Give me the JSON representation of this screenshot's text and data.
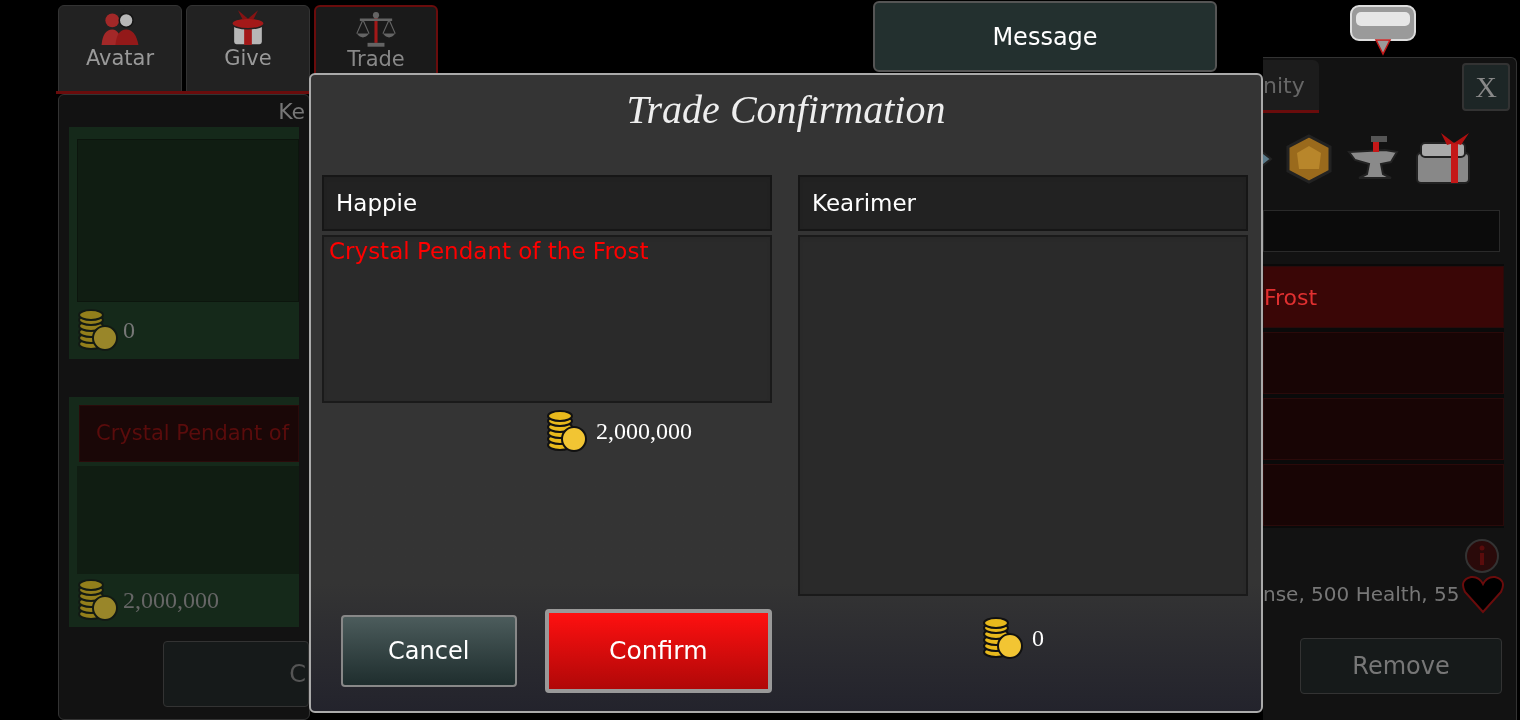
{
  "nav_tabs": [
    {
      "label": "Avatar",
      "selected": false
    },
    {
      "label": "Give",
      "selected": false
    },
    {
      "label": "Trade",
      "selected": true
    }
  ],
  "left_panel": {
    "heading": "Ke",
    "top_offer": {
      "gold": "0"
    },
    "bottom_offer": {
      "item": "Crystal Pendant of",
      "gold": "2,000,000"
    },
    "button": "C"
  },
  "message_button": "Message",
  "right_panel": {
    "tab": "nity",
    "close": "X",
    "list_rows": [
      {
        "label": "Frost",
        "selected": true
      },
      {
        "selected": false
      },
      {
        "selected": false
      },
      {
        "selected": false
      }
    ],
    "description": "nse, 500 Health, 55",
    "button": "Remove"
  },
  "modal": {
    "title": "Trade Confirmation",
    "parties": [
      {
        "name": "Happie",
        "items": [
          "Crystal Pendant of the Frost"
        ],
        "gold": "2,000,000"
      },
      {
        "name": "Kearimer",
        "gold": "0"
      }
    ],
    "buttons": [
      {
        "label": "Cancel",
        "kind": "cancel"
      },
      {
        "label": "Confirm",
        "kind": "confirm"
      }
    ]
  }
}
